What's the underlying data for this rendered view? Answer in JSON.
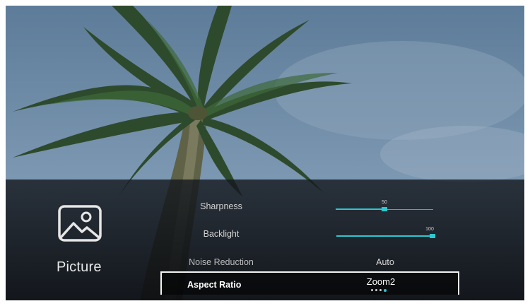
{
  "category": {
    "label": "Picture",
    "icon": "picture-icon"
  },
  "settings": [
    {
      "label": "Sharpness",
      "type": "slider",
      "value": 50,
      "value_label": "50"
    },
    {
      "label": "Backlight",
      "type": "slider",
      "value": 100,
      "value_label": "100"
    },
    {
      "label": "Noise Reduction",
      "type": "option",
      "value": "Auto"
    },
    {
      "label": "Aspect Ratio",
      "type": "option",
      "value": "Zoom2",
      "focused": true,
      "option_count": 4,
      "selected_index": 3
    }
  ],
  "colors": {
    "accent": "#2cc7cf",
    "panel": "#14181e",
    "sky": "#6d8ba6"
  }
}
